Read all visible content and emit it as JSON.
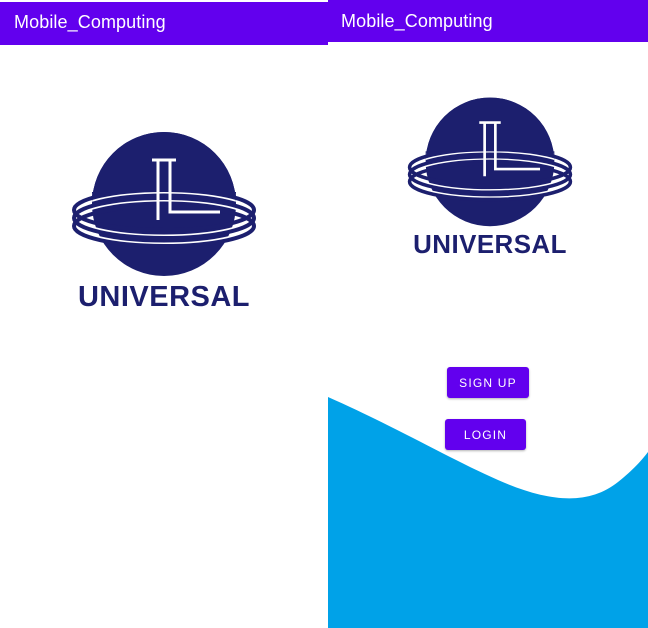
{
  "screens": [
    {
      "app_bar": {
        "title": "Mobile_Computing"
      },
      "logo": {
        "text": "UNIVERSAL"
      }
    },
    {
      "app_bar": {
        "title": "Mobile_Computing"
      },
      "logo": {
        "text": "UNIVERSAL"
      },
      "buttons": {
        "signup_label": "SIGN UP",
        "login_label": "LOGIN"
      }
    }
  ],
  "colors": {
    "app_bar": "#6200ee",
    "button": "#6200ee",
    "logo": "#1c1f6e",
    "wave": "#00a2e8",
    "background": "#ffffff"
  }
}
